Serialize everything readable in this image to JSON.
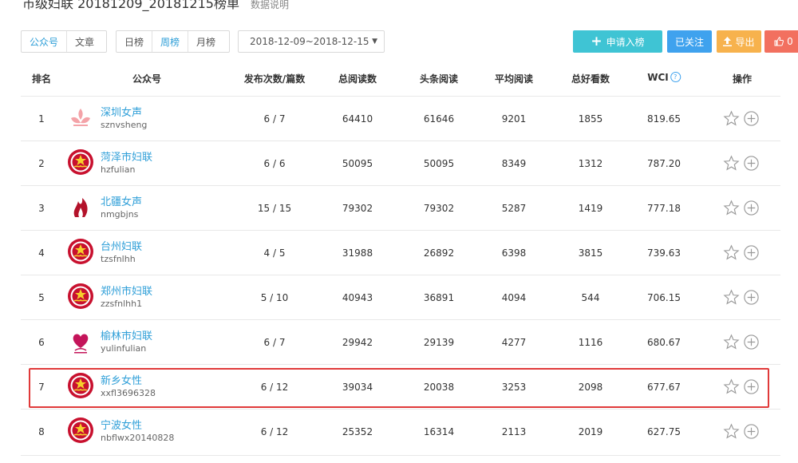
{
  "header": {
    "title": "市级妇联 20181209_20181215榜单",
    "data_note": "数据说明"
  },
  "toolbar": {
    "type_tabs": [
      "公众号",
      "文章"
    ],
    "period_tabs": [
      "日榜",
      "周榜",
      "月榜"
    ],
    "active_period": "周榜",
    "date_range": "2018-12-09~2018-12-15",
    "apply_button": "申请入榜",
    "follow_button": "已关注",
    "export_button": "导出",
    "like_count": "0"
  },
  "colors": {
    "accent": "#2f9fd8",
    "apply": "#3fc4d4",
    "follow": "#3fa2ee",
    "export": "#f7b24d",
    "like": "#f2705f",
    "highlight": "#e03a3a"
  },
  "table": {
    "columns": [
      "排名",
      "公众号",
      "发布次数/篇数",
      "总阅读数",
      "头条阅读",
      "平均阅读",
      "总好看数",
      "WCI",
      "操作"
    ],
    "rows": [
      {
        "rank": "1",
        "name": "深圳女声",
        "id": "sznvsheng",
        "posts": "6 / 7",
        "total_reads": "64410",
        "headline_reads": "61646",
        "avg_reads": "9201",
        "likes": "1855",
        "wci": "819.65",
        "logo": "lotus-logo"
      },
      {
        "rank": "2",
        "name": "菏泽市妇联",
        "id": "hzfulian",
        "posts": "6 / 6",
        "total_reads": "50095",
        "headline_reads": "50095",
        "avg_reads": "8349",
        "likes": "1312",
        "wci": "787.20",
        "logo": "womens-federation-emblem"
      },
      {
        "rank": "3",
        "name": "北疆女声",
        "id": "nmgbjns",
        "posts": "15 / 15",
        "total_reads": "79302",
        "headline_reads": "79302",
        "avg_reads": "5287",
        "likes": "1419",
        "wci": "777.18",
        "logo": "flame-logo"
      },
      {
        "rank": "4",
        "name": "台州妇联",
        "id": "tzsfnlhh",
        "posts": "4 / 5",
        "total_reads": "31988",
        "headline_reads": "26892",
        "avg_reads": "6398",
        "likes": "3815",
        "wci": "739.63",
        "logo": "womens-federation-emblem"
      },
      {
        "rank": "5",
        "name": "郑州市妇联",
        "id": "zzsfnlhh1",
        "posts": "5 / 10",
        "total_reads": "40943",
        "headline_reads": "36891",
        "avg_reads": "4094",
        "likes": "544",
        "wci": "706.15",
        "logo": "womens-federation-emblem"
      },
      {
        "rank": "6",
        "name": "榆林市妇联",
        "id": "yulinfulian",
        "posts": "6 / 7",
        "total_reads": "29942",
        "headline_reads": "29139",
        "avg_reads": "4277",
        "likes": "1116",
        "wci": "680.67",
        "logo": "heart-logo"
      },
      {
        "rank": "7",
        "name": "新乡女性",
        "id": "xxfl3696328",
        "posts": "6 / 12",
        "total_reads": "39034",
        "headline_reads": "20038",
        "avg_reads": "3253",
        "likes": "2098",
        "wci": "677.67",
        "logo": "womens-federation-emblem"
      },
      {
        "rank": "8",
        "name": "宁波女性",
        "id": "nbflwx20140828",
        "posts": "6 / 12",
        "total_reads": "25352",
        "headline_reads": "16314",
        "avg_reads": "2113",
        "likes": "2019",
        "wci": "627.75",
        "logo": "womens-federation-emblem"
      }
    ]
  }
}
